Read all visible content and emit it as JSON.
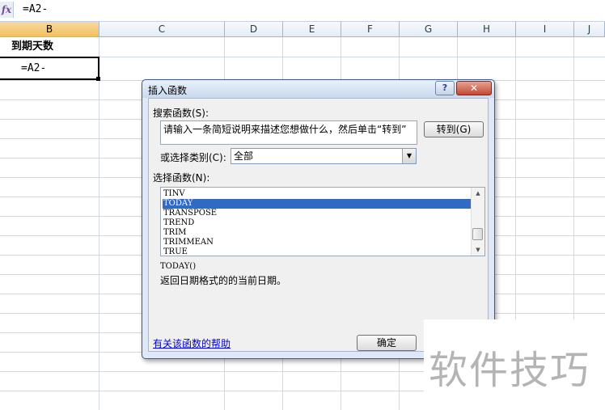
{
  "formula_bar": {
    "fx_label": "fx",
    "formula": "=A2-"
  },
  "columns": [
    "B",
    "C",
    "D",
    "E",
    "F",
    "G",
    "H",
    "I",
    "J"
  ],
  "cells": {
    "b1": "到期天数",
    "b2": "=A2-"
  },
  "dialog": {
    "title": "插入函数",
    "help_button": "?",
    "close_button": "✕",
    "search_label": "搜索函数(S):",
    "search_text": "请输入一条简短说明来描述您想做什么，然后单击“转到”",
    "goto_button": "转到(G)",
    "category_label": "或选择类别(C):",
    "category_value": "全部",
    "function_label": "选择函数(N):",
    "functions": [
      "TINV",
      "TODAY",
      "TRANSPOSE",
      "TREND",
      "TRIM",
      "TRIMMEAN",
      "TRUE"
    ],
    "selected_function": "TODAY",
    "signature": "TODAY()",
    "description": "返回日期格式的的当前日期。",
    "help_link": "有关该函数的帮助",
    "ok_button": "确定"
  },
  "watermark": "软件技巧",
  "colors": {
    "selection": "#316ac5",
    "active_header": "#f1c15f",
    "dialog_frame": "#3b5a8a",
    "link": "#0000cc"
  }
}
